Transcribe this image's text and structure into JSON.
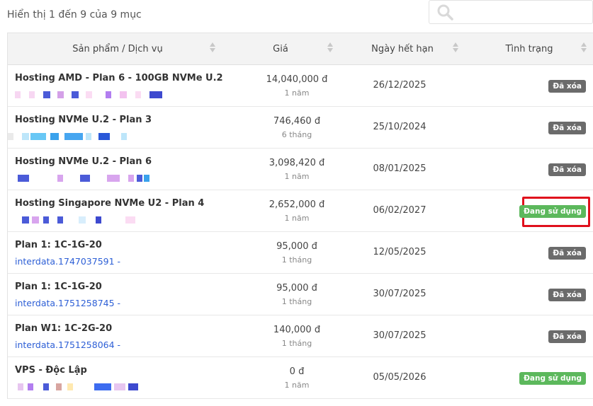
{
  "info_text": "Hiển thị 1 đến 9 của 9 mục",
  "search": {
    "placeholder": ""
  },
  "columns": {
    "product": "Sản phẩm / Dịch vụ",
    "price": "Giá",
    "expiry": "Ngày hết hạn",
    "status": "Tình trạng"
  },
  "rows": [
    {
      "name": "Hosting AMD - Plan 6 - 100GB NVMe U.2",
      "sub": "",
      "price": "14,040,000 đ",
      "cycle": "1 năm",
      "date": "26/12/2025",
      "status": "Đã xóa",
      "status_type": "deleted"
    },
    {
      "name": "Hosting NVMe U.2 - Plan 3",
      "sub": "",
      "price": "746,460 đ",
      "cycle": "6 tháng",
      "date": "25/10/2024",
      "status": "Đã xóa",
      "status_type": "deleted"
    },
    {
      "name": "Hosting NVMe U.2 - Plan 6",
      "sub": "",
      "price": "3,098,420 đ",
      "cycle": "1 năm",
      "date": "08/01/2025",
      "status": "Đã xóa",
      "status_type": "deleted"
    },
    {
      "name": "Hosting Singapore NVMe U2 - Plan 4",
      "sub": "",
      "price": "2,652,000 đ",
      "cycle": "1 năm",
      "date": "06/02/2027",
      "status": "Đang sử dụng",
      "status_type": "active"
    },
    {
      "name": "Plan 1: 1C-1G-20",
      "sub": "interdata.1747037591 -",
      "price": "95,000 đ",
      "cycle": "1 tháng",
      "date": "12/05/2025",
      "status": "Đã xóa",
      "status_type": "deleted"
    },
    {
      "name": "Plan 1: 1C-1G-20",
      "sub": "interdata.1751258745 -",
      "price": "95,000 đ",
      "cycle": "1 tháng",
      "date": "30/07/2025",
      "status": "Đã xóa",
      "status_type": "deleted"
    },
    {
      "name": "Plan W1: 1C-2G-20",
      "sub": "interdata.1751258064 -",
      "price": "140,000 đ",
      "cycle": "1 tháng",
      "date": "30/07/2025",
      "status": "Đã xóa",
      "status_type": "deleted"
    },
    {
      "name": "VPS - Độc Lập",
      "sub": "",
      "price": "0 đ",
      "cycle": "1 năm",
      "date": "05/05/2026",
      "status": "Đang sử dụng",
      "status_type": "active"
    }
  ],
  "colors": {
    "deleted_badge": "#6b6b6b",
    "active_badge": "#5cb85c",
    "link": "#2d5fd6",
    "highlight_box": "#e0101c"
  }
}
